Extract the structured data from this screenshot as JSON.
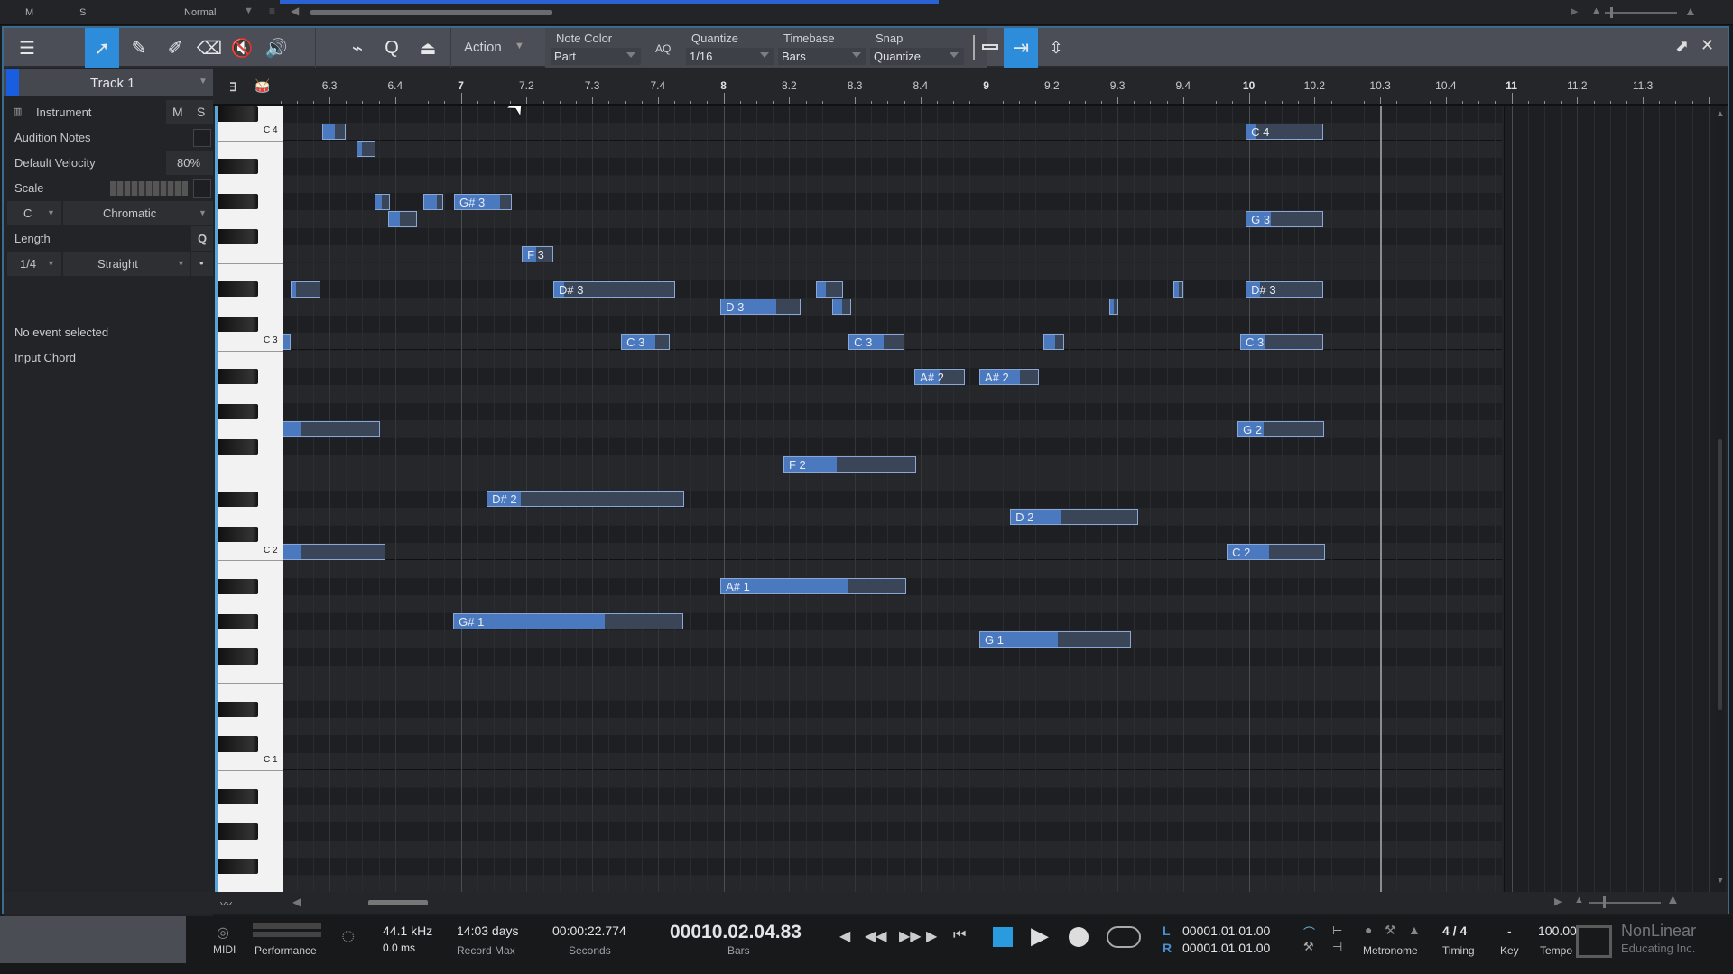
{
  "top_strip": {
    "mute": "M",
    "solo": "S",
    "mode": "Normal"
  },
  "toolbar": {
    "action_label": "Action",
    "note_color": {
      "label": "Note Color",
      "value": "Part"
    },
    "aq_label": "AQ",
    "quantize": {
      "label": "Quantize",
      "value": "1/16"
    },
    "timebase": {
      "label": "Timebase",
      "value": "Bars"
    },
    "snap": {
      "label": "Snap",
      "value": "Quantize"
    },
    "tools": [
      "menu-icon",
      "arrow-tool-icon",
      "pencil-tool-icon",
      "paint-tool-icon",
      "eraser-tool-icon",
      "mute-tool-icon",
      "listen-tool-icon"
    ],
    "active_tool": "arrow-tool-icon"
  },
  "inspector": {
    "track_name": "Track 1",
    "instrument_label": "Instrument",
    "m_label": "M",
    "s_label": "S",
    "audition_notes_label": "Audition Notes",
    "default_velocity_label": "Default Velocity",
    "default_velocity_value": "80%",
    "scale_label": "Scale",
    "scale_root": "C",
    "scale_type": "Chromatic",
    "length_label": "Length",
    "length_q": "Q",
    "length_value": "1/4",
    "length_mode": "Straight",
    "length_dot": "•",
    "no_event": "No event selected",
    "input_chord": "Input Chord"
  },
  "ruler": {
    "labels": [
      {
        "text": "6.3",
        "pos": 6.5,
        "bar": false
      },
      {
        "text": "6.4",
        "pos": 6.75,
        "bar": false
      },
      {
        "text": "7",
        "pos": 7.0,
        "bar": true
      },
      {
        "text": "7.2",
        "pos": 7.25,
        "bar": false
      },
      {
        "text": "7.3",
        "pos": 7.5,
        "bar": false
      },
      {
        "text": "7.4",
        "pos": 7.75,
        "bar": false
      },
      {
        "text": "8",
        "pos": 8.0,
        "bar": true
      },
      {
        "text": "8.2",
        "pos": 8.25,
        "bar": false
      },
      {
        "text": "8.3",
        "pos": 8.5,
        "bar": false
      },
      {
        "text": "8.4",
        "pos": 8.75,
        "bar": false
      },
      {
        "text": "9",
        "pos": 9.0,
        "bar": true
      },
      {
        "text": "9.2",
        "pos": 9.25,
        "bar": false
      },
      {
        "text": "9.3",
        "pos": 9.5,
        "bar": false
      },
      {
        "text": "9.4",
        "pos": 9.75,
        "bar": false
      },
      {
        "text": "10",
        "pos": 10.0,
        "bar": true
      },
      {
        "text": "10.2",
        "pos": 10.25,
        "bar": false
      },
      {
        "text": "10.3",
        "pos": 10.5,
        "bar": false
      },
      {
        "text": "10.4",
        "pos": 10.75,
        "bar": false
      },
      {
        "text": "11",
        "pos": 11.0,
        "bar": true
      },
      {
        "text": "11.2",
        "pos": 11.25,
        "bar": false
      },
      {
        "text": "11.3",
        "pos": 11.5,
        "bar": false
      }
    ],
    "song_end": 10.5
  },
  "keyboard": {
    "octave_labels": [
      {
        "text": "C 4",
        "semi": 0
      },
      {
        "text": "C 3",
        "semi": 12
      },
      {
        "text": "C 2",
        "semi": 24
      },
      {
        "text": "C 1",
        "semi": 36
      }
    ]
  },
  "notes": [
    {
      "label": "",
      "semi": 0,
      "start": 6.472,
      "end": 6.561,
      "vel": 0.55
    },
    {
      "label": "C 4",
      "semi": 0,
      "start": 9.988,
      "end": 10.284,
      "vel": 0.12
    },
    {
      "label": "",
      "semi": 1,
      "start": 6.603,
      "end": 6.675,
      "vel": 0.28
    },
    {
      "label": "",
      "semi": 4,
      "start": 6.671,
      "end": 6.729,
      "vel": 0.5
    },
    {
      "label": "",
      "semi": 4,
      "start": 6.857,
      "end": 6.933,
      "vel": 0.7
    },
    {
      "label": "G# 3",
      "semi": 4,
      "start": 6.974,
      "end": 7.194,
      "vel": 0.8
    },
    {
      "label": "",
      "semi": 5,
      "start": 6.723,
      "end": 6.833,
      "vel": 0.4
    },
    {
      "label": "G 3",
      "semi": 5,
      "start": 9.988,
      "end": 10.284,
      "vel": 0.32
    },
    {
      "label": "F 3",
      "semi": 7,
      "start": 7.232,
      "end": 7.352,
      "vel": 0.45
    },
    {
      "label": "",
      "semi": 9,
      "start": 6.351,
      "end": 6.465,
      "vel": 0.18
    },
    {
      "label": "D# 3",
      "semi": 9,
      "start": 7.352,
      "end": 7.816,
      "vel": 0.08
    },
    {
      "label": "",
      "semi": 9,
      "start": 8.352,
      "end": 8.455,
      "vel": 0.35
    },
    {
      "label": "",
      "semi": 9,
      "start": 9.713,
      "end": 9.751,
      "vel": 0.5
    },
    {
      "label": "D# 3",
      "semi": 9,
      "start": 9.988,
      "end": 10.284,
      "vel": 0.18
    },
    {
      "label": "D 3",
      "semi": 10,
      "start": 7.988,
      "end": 8.294,
      "vel": 0.7
    },
    {
      "label": "",
      "semi": 10,
      "start": 8.414,
      "end": 8.486,
      "vel": 0.55
    },
    {
      "label": "",
      "semi": 10,
      "start": 9.469,
      "end": 9.503,
      "vel": 0.5
    },
    {
      "label": "",
      "semi": 12,
      "start": 6.321,
      "end": 6.351,
      "vel": 1.0
    },
    {
      "label": "C 3",
      "semi": 12,
      "start": 7.61,
      "end": 7.796,
      "vel": 0.7
    },
    {
      "label": "C 3",
      "semi": 12,
      "start": 8.476,
      "end": 8.689,
      "vel": 0.63
    },
    {
      "label": "",
      "semi": 12,
      "start": 9.218,
      "end": 9.297,
      "vel": 0.55
    },
    {
      "label": "C 3",
      "semi": 12,
      "start": 9.967,
      "end": 10.284,
      "vel": 0.3
    },
    {
      "label": "A# 2",
      "semi": 14,
      "start": 8.727,
      "end": 8.919,
      "vel": 0.5
    },
    {
      "label": "A# 2",
      "semi": 14,
      "start": 8.974,
      "end": 9.201,
      "vel": 0.68
    },
    {
      "label": "",
      "semi": 17,
      "start": 6.321,
      "end": 6.692,
      "vel": 0.18
    },
    {
      "label": "G 2",
      "semi": 17,
      "start": 9.957,
      "end": 10.287,
      "vel": 0.3
    },
    {
      "label": "F 2",
      "semi": 19,
      "start": 8.228,
      "end": 8.733,
      "vel": 0.4
    },
    {
      "label": "D# 2",
      "semi": 21,
      "start": 7.098,
      "end": 7.851,
      "vel": 0.17
    },
    {
      "label": "D 2",
      "semi": 22,
      "start": 9.091,
      "end": 9.579,
      "vel": 0.4
    },
    {
      "label": "",
      "semi": 24,
      "start": 6.321,
      "end": 6.713,
      "vel": 0.18
    },
    {
      "label": "C 2",
      "semi": 24,
      "start": 9.916,
      "end": 10.291,
      "vel": 0.43
    },
    {
      "label": "A# 1",
      "semi": 26,
      "start": 7.988,
      "end": 8.697,
      "vel": 0.69
    },
    {
      "label": "G# 1",
      "semi": 28,
      "start": 6.971,
      "end": 7.847,
      "vel": 0.66
    },
    {
      "label": "G 1",
      "semi": 29,
      "start": 8.974,
      "end": 9.551,
      "vel": 0.52
    }
  ],
  "status": {
    "midi_label": "MIDI",
    "performance_label": "Performance",
    "sample_rate": "44.1 kHz",
    "latency": "0.0 ms",
    "record_max_value": "14:03 days",
    "record_max_label": "Record Max",
    "seconds_value": "00:00:22.774",
    "seconds_label": "Seconds",
    "bars_value": "00010.02.04.83",
    "bars_label": "Bars",
    "loop_l_label": "L",
    "loop_l_value": "00001.01.01.00",
    "loop_r_label": "R",
    "loop_r_value": "00001.01.01.00",
    "metronome_label": "Metronome",
    "timing_value": "4 / 4",
    "timing_label": "Timing",
    "key_value": "-",
    "key_label": "Key",
    "tempo_value": "100.00",
    "tempo_label": "Tempo",
    "watermark_line1": "NonLinear",
    "watermark_line2": "Educating Inc."
  }
}
